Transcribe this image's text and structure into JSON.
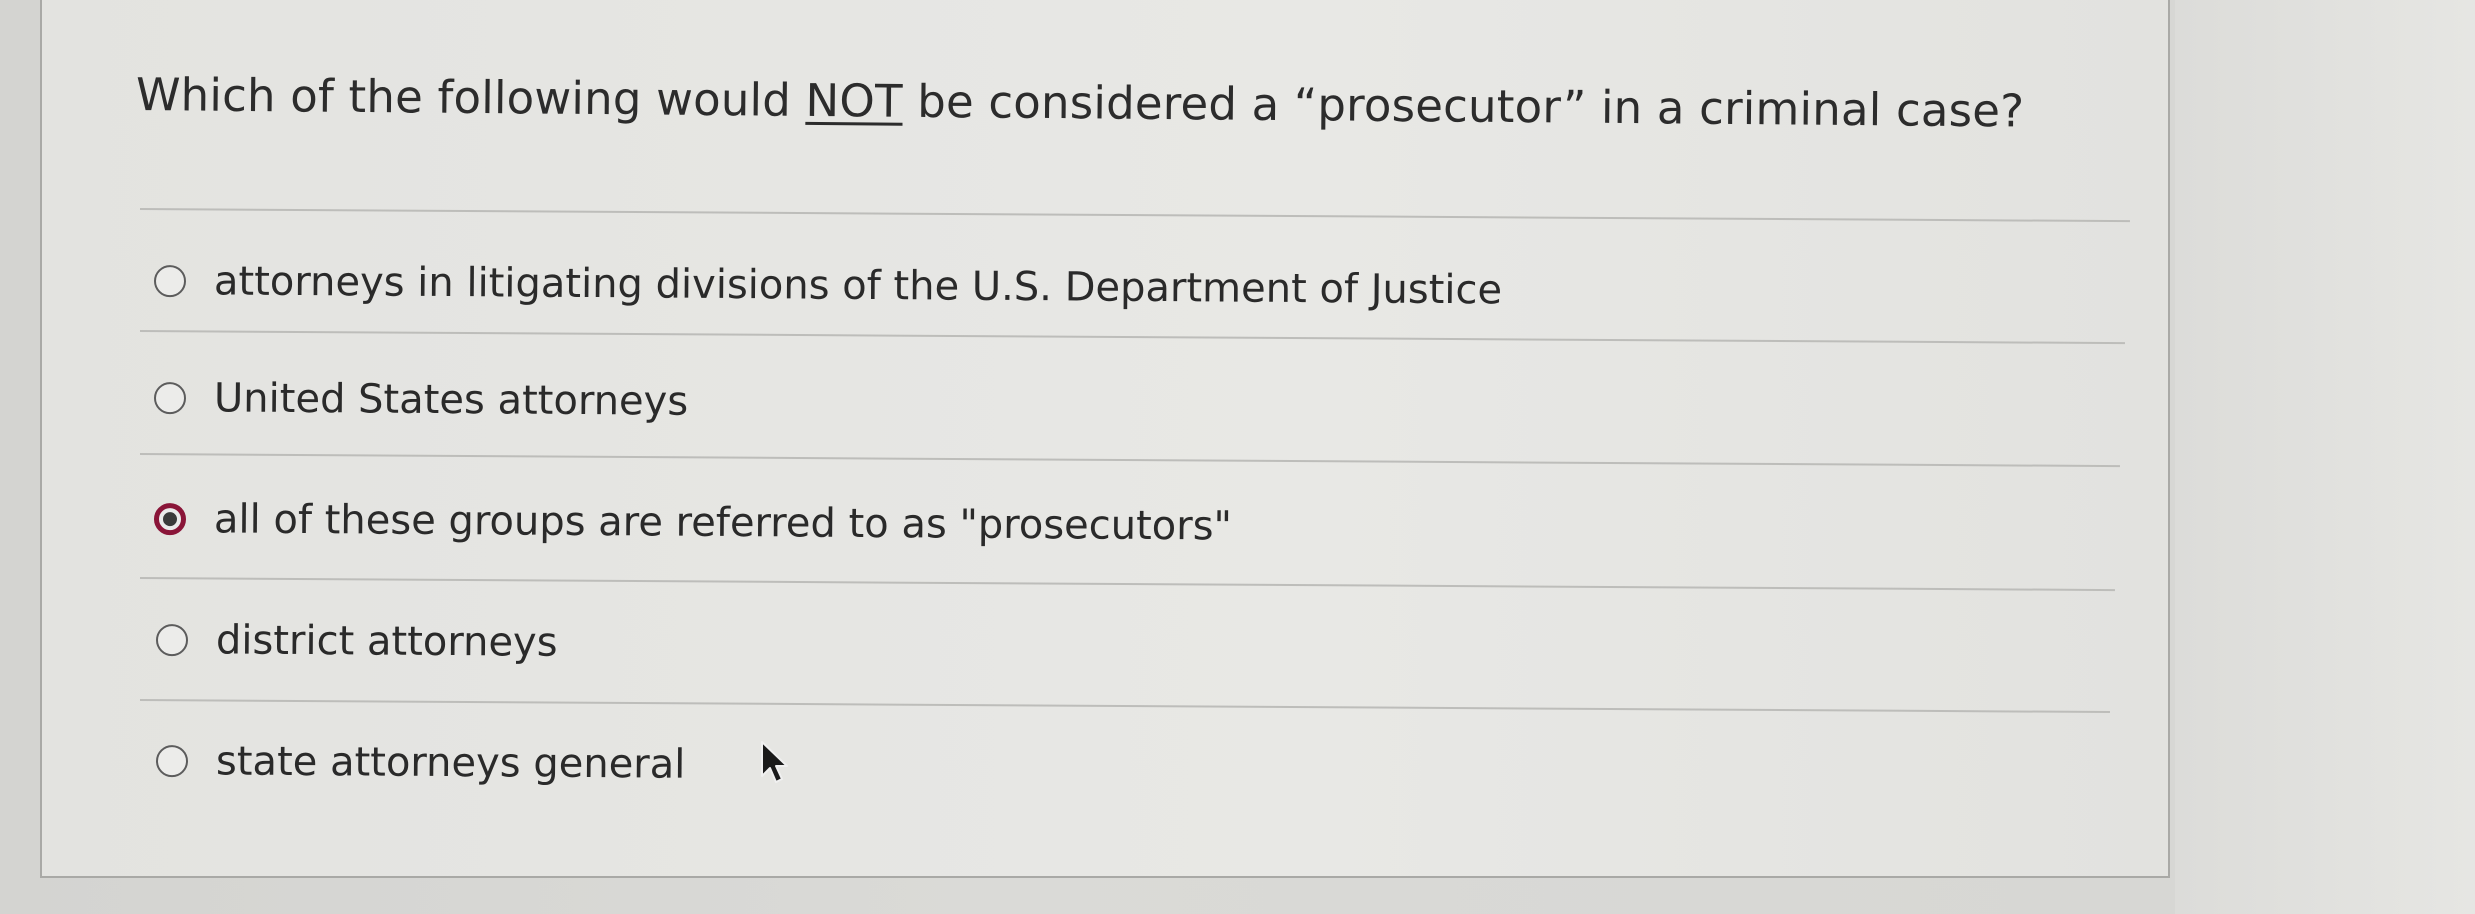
{
  "question": {
    "prefix": "Which of the following would ",
    "emphasis": "NOT",
    "suffix": " be considered a “prosecutor” in a criminal case?"
  },
  "options": [
    {
      "label": "attorneys in litigating divisions of the U.S. Department of Justice",
      "selected": false
    },
    {
      "label": "United States attorneys",
      "selected": false
    },
    {
      "label": "all of these groups are referred to as \"prosecutors\"",
      "selected": true
    },
    {
      "label": "district attorneys",
      "selected": false
    },
    {
      "label": "state attorneys general",
      "selected": false
    }
  ],
  "colors": {
    "selected_ring": "#8a1538",
    "text": "#2a2a2a",
    "divider": "#bdbdba"
  },
  "icons": {
    "cursor": "mouse-pointer-icon"
  }
}
